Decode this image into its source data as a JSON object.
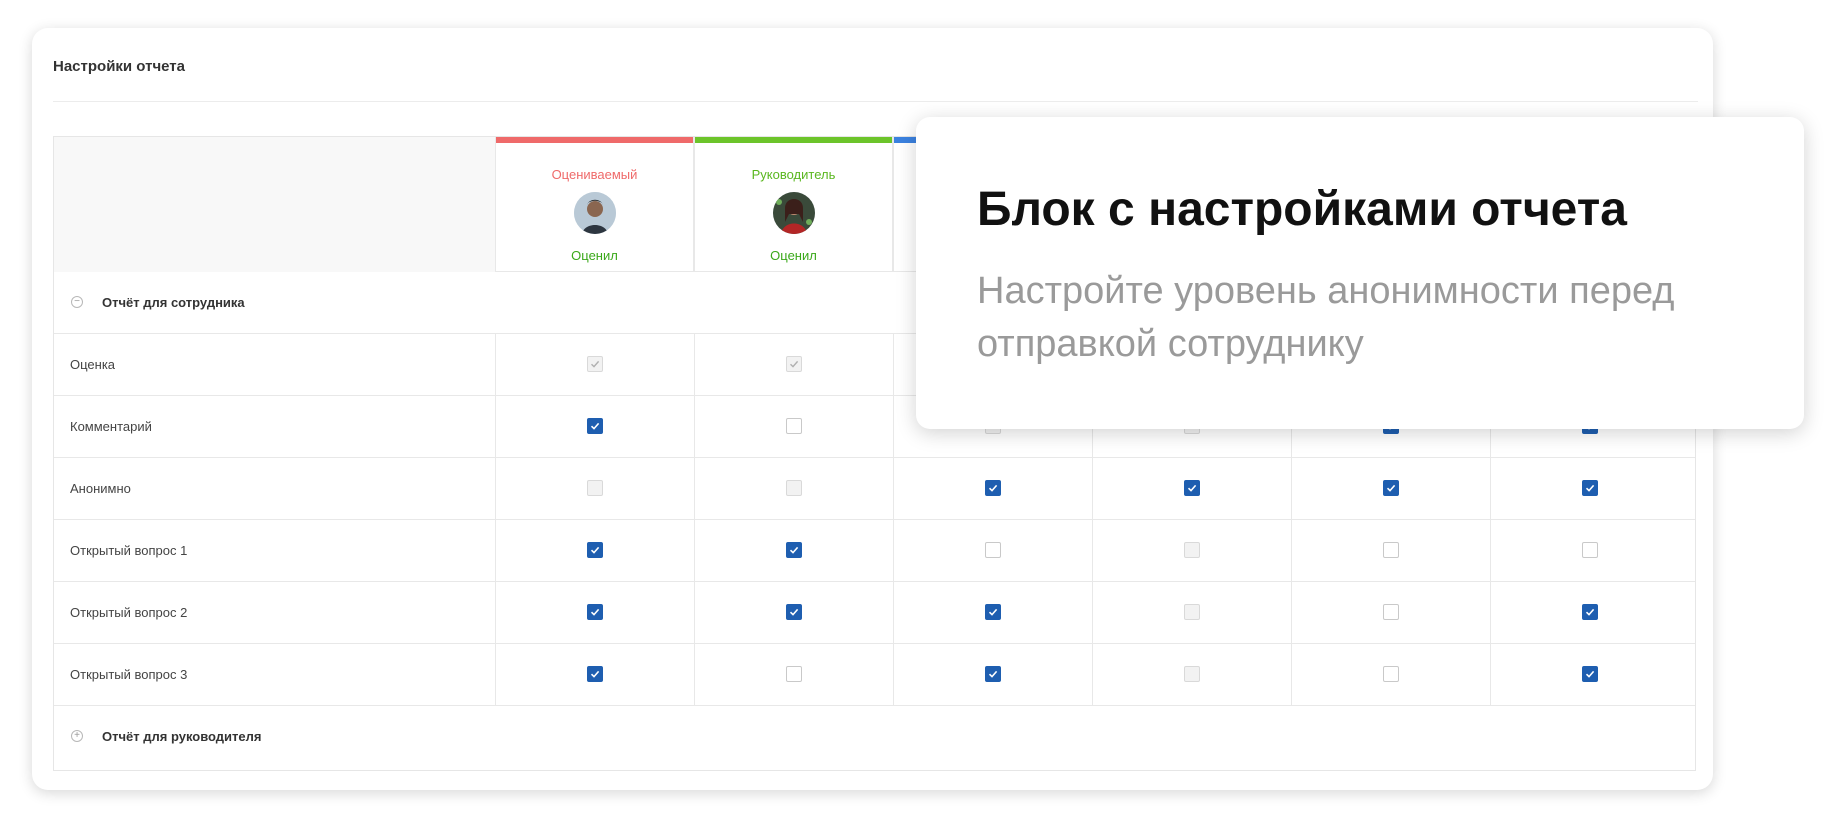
{
  "card": {
    "title": "Настройки отчета"
  },
  "columns": [
    {
      "role": "Оцениваемый",
      "role_color": "#ef6a6a",
      "bar_color": "#ef6a6a",
      "status": "Оценил"
    },
    {
      "role": "Руководитель",
      "role_color": "#5ab71f",
      "bar_color": "#6cc42a",
      "status": "Оценил"
    },
    {
      "role": "",
      "role_color": "#3b82e0",
      "bar_color": "#3b82e0",
      "status": ""
    }
  ],
  "sections": {
    "employee": {
      "label": "Отчёт для сотрудника",
      "toggle": "−"
    },
    "manager": {
      "label": "Отчёт для руководителя",
      "toggle": "+"
    }
  },
  "rows": [
    {
      "label": "Оценка",
      "cells": [
        "disabled-checked",
        "disabled-checked",
        "hidden",
        "hidden",
        "hidden",
        "hidden"
      ]
    },
    {
      "label": "Комментарий",
      "cells": [
        "checked",
        "unchecked",
        "disabled",
        "disabled",
        "checked",
        "checked"
      ]
    },
    {
      "label": "Анонимно",
      "cells": [
        "disabled",
        "disabled",
        "checked",
        "checked",
        "checked",
        "checked"
      ]
    },
    {
      "label": "Открытый вопрос 1",
      "cells": [
        "checked",
        "checked",
        "unchecked",
        "disabled",
        "unchecked",
        "unchecked"
      ]
    },
    {
      "label": "Открытый вопрос 2",
      "cells": [
        "checked",
        "checked",
        "checked",
        "disabled",
        "unchecked",
        "checked"
      ]
    },
    {
      "label": "Открытый вопрос 3",
      "cells": [
        "checked",
        "unchecked",
        "checked",
        "disabled",
        "unchecked",
        "checked"
      ]
    }
  ],
  "overlay": {
    "heading": "Блок с настройками отчета",
    "subtext": "Настройте уровень анонимности перед отправкой сотруднику"
  },
  "colors": {
    "checkbox_on": "#1e5eb0",
    "status_green": "#3aa819"
  }
}
